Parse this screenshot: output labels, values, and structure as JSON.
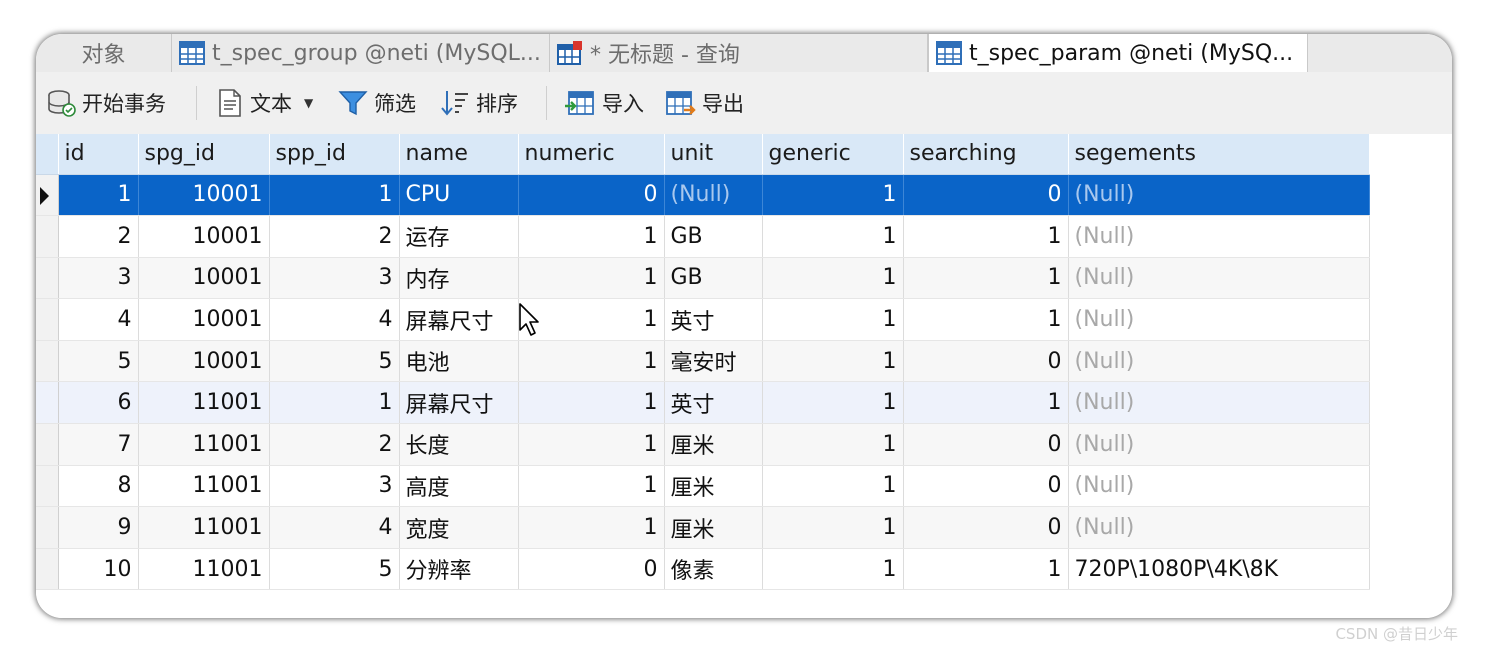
{
  "tabs": [
    {
      "label": "对象",
      "active": false
    },
    {
      "label": "t_spec_group @neti (MySQL...",
      "active": false,
      "icon": "table-icon"
    },
    {
      "label": "* 无标题 - 查询",
      "active": false,
      "icon": "query-icon"
    },
    {
      "label": "t_spec_param @neti (MySQ...",
      "active": true,
      "icon": "table-icon"
    }
  ],
  "toolbar": {
    "begin_transaction": "开始事务",
    "text": "文本",
    "filter": "筛选",
    "sort": "排序",
    "import": "导入",
    "export": "导出"
  },
  "grid": {
    "columns": [
      "id",
      "spg_id",
      "spp_id",
      "name",
      "numeric",
      "unit",
      "generic",
      "searching",
      "segements"
    ],
    "selected_row": 0,
    "rows": [
      {
        "id": "1",
        "spg_id": "10001",
        "spp_id": "1",
        "name": "CPU",
        "numeric": "0",
        "unit": "(Null)",
        "generic": "1",
        "searching": "0",
        "segements": "(Null)"
      },
      {
        "id": "2",
        "spg_id": "10001",
        "spp_id": "2",
        "name": "运存",
        "numeric": "1",
        "unit": "GB",
        "generic": "1",
        "searching": "1",
        "segements": "(Null)"
      },
      {
        "id": "3",
        "spg_id": "10001",
        "spp_id": "3",
        "name": "内存",
        "numeric": "1",
        "unit": "GB",
        "generic": "1",
        "searching": "1",
        "segements": "(Null)"
      },
      {
        "id": "4",
        "spg_id": "10001",
        "spp_id": "4",
        "name": "屏幕尺寸",
        "numeric": "1",
        "unit": "英寸",
        "generic": "1",
        "searching": "1",
        "segements": "(Null)"
      },
      {
        "id": "5",
        "spg_id": "10001",
        "spp_id": "5",
        "name": "电池",
        "numeric": "1",
        "unit": "毫安时",
        "generic": "1",
        "searching": "0",
        "segements": "(Null)"
      },
      {
        "id": "6",
        "spg_id": "11001",
        "spp_id": "1",
        "name": "屏幕尺寸",
        "numeric": "1",
        "unit": "英寸",
        "generic": "1",
        "searching": "1",
        "segements": "(Null)"
      },
      {
        "id": "7",
        "spg_id": "11001",
        "spp_id": "2",
        "name": "长度",
        "numeric": "1",
        "unit": "厘米",
        "generic": "1",
        "searching": "0",
        "segements": "(Null)"
      },
      {
        "id": "8",
        "spg_id": "11001",
        "spp_id": "3",
        "name": "高度",
        "numeric": "1",
        "unit": "厘米",
        "generic": "1",
        "searching": "0",
        "segements": "(Null)"
      },
      {
        "id": "9",
        "spg_id": "11001",
        "spp_id": "4",
        "name": "宽度",
        "numeric": "1",
        "unit": "厘米",
        "generic": "1",
        "searching": "0",
        "segements": "(Null)"
      },
      {
        "id": "10",
        "spg_id": "11001",
        "spp_id": "5",
        "name": "分辨率",
        "numeric": "0",
        "unit": "像素",
        "generic": "1",
        "searching": "1",
        "segements": "720P\\1080P\\4K\\8K"
      }
    ]
  },
  "watermark": "CSDN @昔日少年",
  "colors": {
    "selection": "#0a64c8",
    "header": "#d9e8f7",
    "null_text": "#a8a8a8"
  }
}
